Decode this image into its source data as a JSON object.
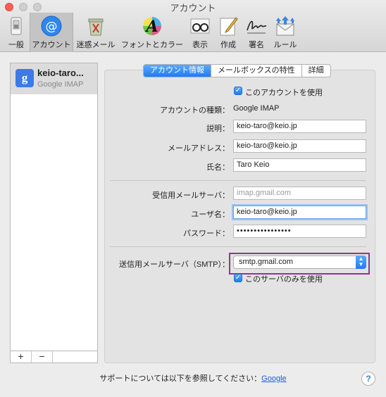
{
  "window": {
    "title": "アカウント"
  },
  "toolbar": {
    "items": [
      {
        "label": "一般",
        "icon": "general-switch-icon"
      },
      {
        "label": "アカウント",
        "icon": "at-sign-icon",
        "selected": true
      },
      {
        "label": "迷惑メール",
        "icon": "trash-can-icon"
      },
      {
        "label": "フォントとカラー",
        "icon": "font-colors-icon"
      },
      {
        "label": "表示",
        "icon": "glasses-icon"
      },
      {
        "label": "作成",
        "icon": "compose-pencil-icon"
      },
      {
        "label": "署名",
        "icon": "signature-icon"
      },
      {
        "label": "ルール",
        "icon": "rules-envelope-icon"
      }
    ]
  },
  "sidebar": {
    "account_name": "keio-taro...",
    "account_type": "Google IMAP",
    "add_label": "+",
    "remove_label": "−"
  },
  "tabs": [
    "アカウント情報",
    "メールボックスの特性",
    "詳細"
  ],
  "form": {
    "use_account_label": "このアカウントを使用",
    "account_kind_label": "アカウントの種類：",
    "account_kind_value": "Google IMAP",
    "description_label": "説明：",
    "description_value": "keio-taro@keio.jp",
    "email_label": "メールアドレス：",
    "email_value": "keio-taro@keio.jp",
    "fullname_label": "氏名：",
    "fullname_value": "Taro Keio",
    "incoming_server_label": "受信用メールサーバ：",
    "incoming_server_placeholder": "imap.gmail.com",
    "username_label": "ユーザ名：",
    "username_value": "keio-taro@keio.jp",
    "password_label": "パスワード：",
    "password_value": "••••••••••••••••",
    "smtp_label": "送信用メールサーバ（SMTP）：",
    "smtp_value": "smtp.gmail.com",
    "smtp_only_label": "このサーバのみを使用"
  },
  "footer": {
    "support_text": "サポートについては以下を参照してください：",
    "support_link": "Google",
    "help_label": "?"
  },
  "colors": {
    "accent": "#1c7df0",
    "highlight_box": "#8b3a8f"
  }
}
